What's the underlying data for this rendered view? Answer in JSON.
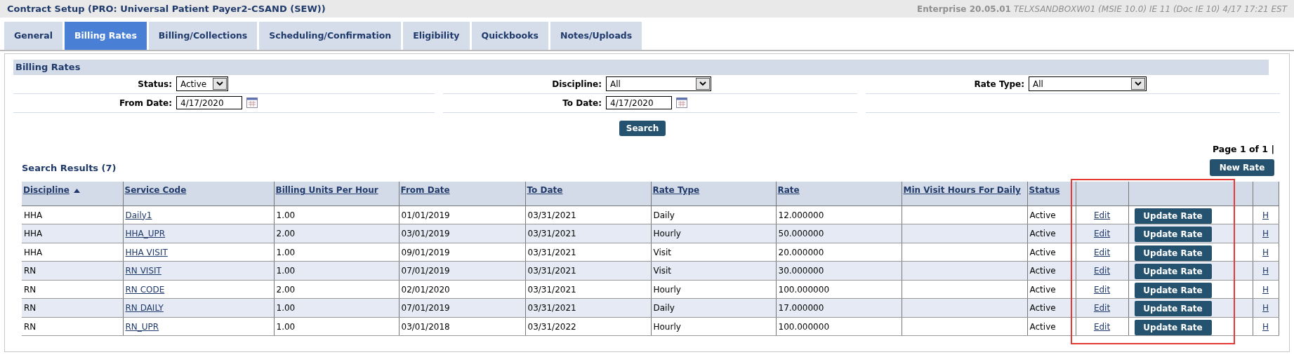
{
  "window": {
    "title": "Contract Setup (PRO: Universal Patient Payer2-CSAND (SEW))",
    "version": "Enterprise 20.05.01",
    "environment": "TELXSANDBOXW01 (MSIE 10.0) IE 11 (Doc IE 10) 4/17 17:21 EST"
  },
  "tabs": [
    {
      "label": "General",
      "selected": false
    },
    {
      "label": "Billing Rates",
      "selected": true
    },
    {
      "label": "Billing/Collections",
      "selected": false
    },
    {
      "label": "Scheduling/Confirmation",
      "selected": false
    },
    {
      "label": "Eligibility",
      "selected": false
    },
    {
      "label": "Quickbooks",
      "selected": false
    },
    {
      "label": "Notes/Uploads",
      "selected": false
    }
  ],
  "section_title": "Billing Rates",
  "filters": [
    [
      {
        "label": "Status:",
        "kind": "select",
        "value": "Active"
      },
      {
        "label": "Discipline:",
        "kind": "select",
        "value": "All"
      },
      {
        "label": "Rate Type:",
        "kind": "select",
        "value": "All"
      }
    ],
    [
      {
        "label": "From Date:",
        "kind": "date",
        "value": "4/17/2020"
      },
      {
        "label": "To Date:",
        "kind": "date",
        "value": "4/17/2020"
      }
    ]
  ],
  "search_button": "Search",
  "pager": "Page 1 of 1 |",
  "results_title": "Search Results (7)",
  "new_button": "New Rate",
  "table": {
    "highlight_actions": true,
    "columns": [
      {
        "label": "Discipline",
        "sorted": true
      },
      {
        "label": "Service Code",
        "sorted": false
      },
      {
        "label": "Billing Units Per Hour",
        "sorted": false
      },
      {
        "label": "From Date",
        "sorted": false
      },
      {
        "label": "To Date",
        "sorted": false
      },
      {
        "label": "Rate Type",
        "sorted": false
      },
      {
        "label": "Rate",
        "sorted": false
      },
      {
        "label": "Min Visit Hours For Daily",
        "sorted": false
      },
      {
        "label": "Status",
        "sorted": false
      }
    ],
    "rows": [
      {
        "cells": [
          "HHA",
          "Daily1",
          "1.00",
          "01/01/2019",
          "03/31/2021",
          "Daily",
          "12.000000",
          "",
          "Active"
        ],
        "edit": "Edit",
        "update": "Update Rate",
        "history": "H"
      },
      {
        "cells": [
          "HHA",
          "HHA_UPR",
          "2.00",
          "03/01/2019",
          "03/31/2021",
          "Hourly",
          "50.000000",
          "",
          "Active"
        ],
        "edit": "Edit",
        "update": "Update Rate",
        "history": "H"
      },
      {
        "cells": [
          "HHA",
          "HHA VISIT",
          "1.00",
          "09/01/2019",
          "03/31/2021",
          "Visit",
          "20.000000",
          "",
          "Active"
        ],
        "edit": "Edit",
        "update": "Update Rate",
        "history": "H"
      },
      {
        "cells": [
          "RN",
          "RN VISIT",
          "1.00",
          "07/01/2019",
          "03/31/2021",
          "Visit",
          "30.000000",
          "",
          "Active"
        ],
        "edit": "Edit",
        "update": "Update Rate",
        "history": "H"
      },
      {
        "cells": [
          "RN",
          "RN CODE",
          "2.00",
          "02/01/2020",
          "03/31/2021",
          "Hourly",
          "100.000000",
          "",
          "Active"
        ],
        "edit": "Edit",
        "update": "Update Rate",
        "history": "H"
      },
      {
        "cells": [
          "RN",
          "RN DAILY",
          "1.00",
          "07/01/2019",
          "03/31/2021",
          "Daily",
          "17.000000",
          "",
          "Active"
        ],
        "edit": "Edit",
        "update": "Update Rate",
        "history": "H"
      },
      {
        "cells": [
          "RN",
          "RN_UPR",
          "1.00",
          "03/01/2018",
          "03/31/2022",
          "Hourly",
          "100.000000",
          "",
          "Active"
        ],
        "edit": "Edit",
        "update": "Update Rate",
        "history": "H"
      }
    ]
  }
}
